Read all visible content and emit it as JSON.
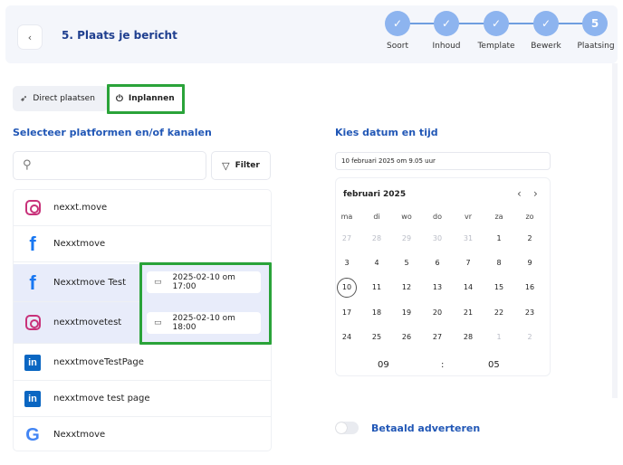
{
  "header": {
    "back_icon": "chevron-left-icon",
    "title": "5. Plaats je bericht",
    "steps": [
      {
        "label": "Soort",
        "marker": "✓"
      },
      {
        "label": "Inhoud",
        "marker": "✓"
      },
      {
        "label": "Template",
        "marker": "✓"
      },
      {
        "label": "Bewerk",
        "marker": "✓"
      },
      {
        "label": "Plaatsing",
        "marker": "5"
      }
    ],
    "step_color": "#8db4ef"
  },
  "mode": {
    "direct_label": "Direct plaatsen",
    "direct_icon": "send-icon",
    "schedule_label": "Inplannen",
    "schedule_icon": "power-icon",
    "selected": "Inplannen"
  },
  "platforms": {
    "title": "Selecteer platformen en/of kanalen",
    "filter_label": "Filter",
    "items": [
      {
        "name": "nexxt.move",
        "type": "instagram",
        "selected": false
      },
      {
        "name": "Nexxtmove",
        "type": "facebook",
        "selected": false
      },
      {
        "name": "Nexxtmove Test",
        "type": "facebook",
        "selected": true,
        "datetime": "2025-02-10 om 17:00"
      },
      {
        "name": "nexxtmovetest",
        "type": "instagram",
        "selected": true,
        "datetime": "2025-02-10 om 18:00"
      },
      {
        "name": "nexxtmoveTestPage",
        "type": "linkedin",
        "selected": false
      },
      {
        "name": "nexxtmove test page",
        "type": "linkedin",
        "selected": false
      },
      {
        "name": "Nexxtmove",
        "type": "google",
        "selected": false
      }
    ]
  },
  "datetime": {
    "title": "Kies datum en tijd",
    "value": "10 februari 2025 om 9.05 uur",
    "calendar": {
      "month": "februari 2025",
      "weekdays": [
        "ma",
        "di",
        "wo",
        "do",
        "vr",
        "za",
        "zo"
      ],
      "weeks": [
        [
          "27",
          "28",
          "29",
          "30",
          "31",
          "1",
          "2"
        ],
        [
          "3",
          "4",
          "5",
          "6",
          "7",
          "8",
          "9"
        ],
        [
          "10",
          "11",
          "12",
          "13",
          "14",
          "15",
          "16"
        ],
        [
          "17",
          "18",
          "19",
          "20",
          "21",
          "22",
          "23"
        ],
        [
          "24",
          "25",
          "26",
          "27",
          "28",
          "1",
          "2"
        ]
      ],
      "selected_day": "10",
      "hour": "09",
      "separator": ":",
      "minute": "05"
    }
  },
  "paid": {
    "label": "Betaald adverteren",
    "enabled": false
  },
  "highlight_color": "#2aa339"
}
